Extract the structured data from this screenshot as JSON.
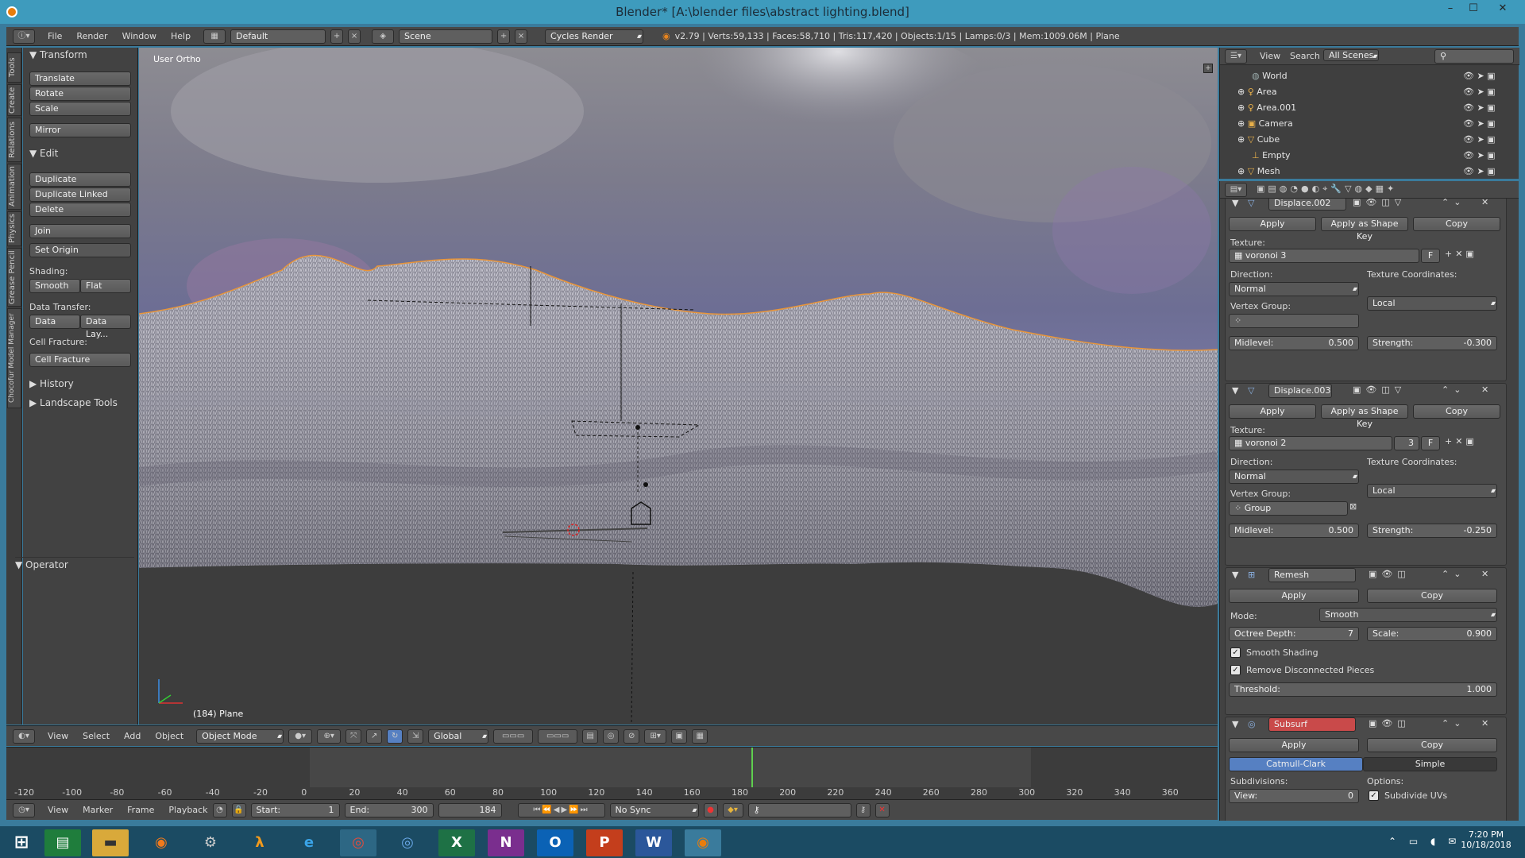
{
  "window": {
    "title": "Blender* [A:\\blender files\\abstract lighting.blend]",
    "minimize": "–",
    "maximize": "☐",
    "close": "✕"
  },
  "infobar": {
    "menus": [
      "File",
      "Render",
      "Window",
      "Help"
    ],
    "layout": "Default",
    "scene": "Scene",
    "engine": "Cycles Render",
    "stats": "v2.79 | Verts:59,133 | Faces:58,710 | Tris:117,420 | Objects:1/15 | Lamps:0/3 | Mem:1009.06M | Plane"
  },
  "lefttabs": [
    "Tools",
    "Create",
    "Relations",
    "Animation",
    "Physics",
    "Grease Pencil",
    "Chocofur Model Manager"
  ],
  "toolshelf": {
    "transform": {
      "title": "Transform",
      "buttons": [
        "Translate",
        "Rotate",
        "Scale",
        "Mirror"
      ]
    },
    "edit": {
      "title": "Edit",
      "buttons": [
        "Duplicate",
        "Duplicate Linked",
        "Delete",
        "Join"
      ],
      "set_origin": "Set Origin",
      "shading_label": "Shading:",
      "smooth": "Smooth",
      "flat": "Flat",
      "data_transfer_label": "Data Transfer:",
      "data": "Data",
      "data_lay": "Data Lay...",
      "cell_fracture_label": "Cell Fracture:",
      "cell_fracture": "Cell Fracture"
    },
    "history": "History",
    "landscape": "Landscape Tools",
    "operator": "Operator"
  },
  "viewport": {
    "view_label": "User Ortho",
    "object_label": "(184) Plane"
  },
  "viewheader": {
    "menus": [
      "View",
      "Select",
      "Add",
      "Object"
    ],
    "mode": "Object Mode",
    "orientation": "Global"
  },
  "timeline": {
    "ticks": [
      "-120",
      "-100",
      "-80",
      "-60",
      "-40",
      "-20",
      "0",
      "20",
      "40",
      "60",
      "80",
      "100",
      "120",
      "140",
      "160",
      "180",
      "200",
      "220",
      "240",
      "260",
      "280",
      "300",
      "320",
      "340",
      "360"
    ],
    "current_frame": 184
  },
  "timeheader": {
    "menus": [
      "View",
      "Marker",
      "Frame",
      "Playback"
    ],
    "start_label": "Start:",
    "start": "1",
    "end_label": "End:",
    "end": "300",
    "current": "184",
    "sync": "No Sync"
  },
  "outliner": {
    "menus": [
      "View",
      "Search"
    ],
    "scope": "All Scenes",
    "items": [
      "World",
      "Area",
      "Area.001",
      "Camera",
      "Cube",
      "Empty",
      "Mesh"
    ]
  },
  "modifiers": {
    "apply": "Apply",
    "apply_shape": "Apply as Shape Key",
    "copy": "Copy",
    "displace2": {
      "name": "Displace.002",
      "texture_label": "Texture:",
      "texture": "voronoi 3",
      "direction_label": "Direction:",
      "direction": "Normal",
      "coords_label": "Texture Coordinates:",
      "coords": "Local",
      "vgroup_label": "Vertex Group:",
      "vgroup": "",
      "midlevel_label": "Midlevel:",
      "midlevel": "0.500",
      "strength_label": "Strength:",
      "strength": "-0.300",
      "f": "F"
    },
    "displace3": {
      "name": "Displace.003",
      "texture_label": "Texture:",
      "texture": "voronoi 2",
      "users": "3",
      "direction_label": "Direction:",
      "direction": "Normal",
      "coords_label": "Texture Coordinates:",
      "coords": "Local",
      "vgroup_label": "Vertex Group:",
      "vgroup": "Group",
      "midlevel_label": "Midlevel:",
      "midlevel": "0.500",
      "strength_label": "Strength:",
      "strength": "-0.250",
      "f": "F"
    },
    "remesh": {
      "name": "Remesh",
      "mode_label": "Mode:",
      "mode": "Smooth",
      "octree_label": "Octree Depth:",
      "octree": "7",
      "scale_label": "Scale:",
      "scale": "0.900",
      "smooth_shading": "Smooth Shading",
      "remove_disc": "Remove Disconnected Pieces",
      "threshold_label": "Threshold:",
      "threshold": "1.000"
    },
    "subsurf": {
      "name": "Subsurf",
      "catmull": "Catmull-Clark",
      "simple": "Simple",
      "subdivisions_label": "Subdivisions:",
      "options_label": "Options:",
      "view_label": "View:",
      "view": "0",
      "subdivide_uvs": "Subdivide UVs"
    }
  },
  "taskbar": {
    "time": "7:20 PM",
    "date": "10/18/2018"
  }
}
